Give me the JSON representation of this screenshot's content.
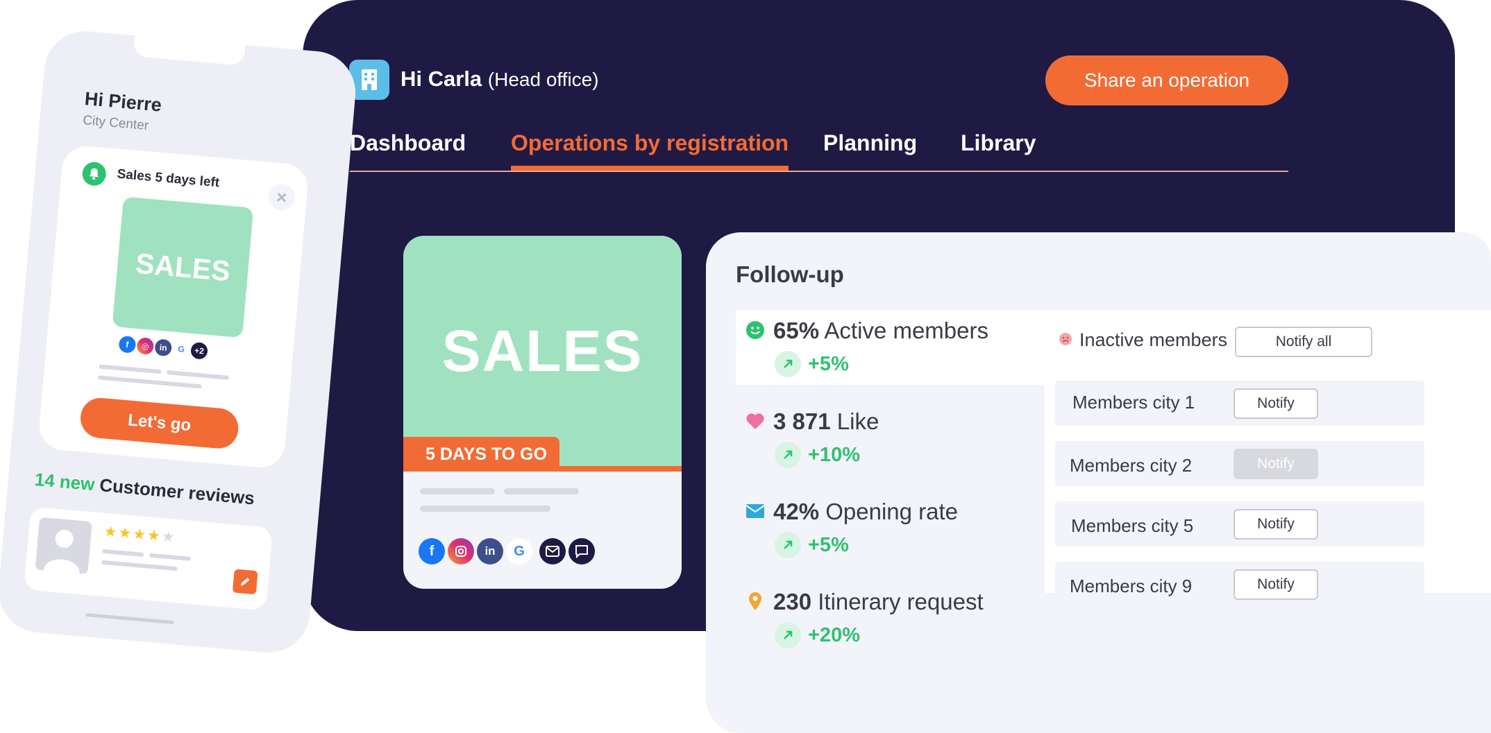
{
  "header": {
    "greeting_name": "Hi Carla",
    "greeting_sub": "(Head office)",
    "share_button": "Share an operation",
    "building_icon": "building-icon"
  },
  "tabs": [
    {
      "label": "Dashboard",
      "active": false
    },
    {
      "label": "Operations by registration",
      "active": true
    },
    {
      "label": "Planning",
      "active": false
    },
    {
      "label": "Library",
      "active": false
    }
  ],
  "sales_card": {
    "banner_text": "SALES",
    "countdown": "5 DAYS TO GO",
    "banner_color": "#a0e2c0",
    "accent_color": "#f26b35",
    "channels": [
      "facebook-icon",
      "instagram-icon",
      "linkedin-icon",
      "google-icon",
      "email-icon",
      "message-icon"
    ]
  },
  "followup": {
    "title": "Follow-up",
    "stats": [
      {
        "icon": "smile-icon",
        "value": "65%",
        "label": "Active members",
        "delta": "+5%"
      },
      {
        "icon": "heart-icon",
        "value": "3 871",
        "label": "Like",
        "delta": "+10%"
      },
      {
        "icon": "envelope-icon",
        "value": "42%",
        "label": "Opening rate",
        "delta": "+5%"
      },
      {
        "icon": "location-pin-icon",
        "value": "230",
        "label": "Itinerary request",
        "delta": "+20%"
      }
    ],
    "inactive": {
      "label": "Inactive members",
      "notify_all": "Notify all",
      "cities": [
        {
          "label": "Members city 1",
          "button": "Notify",
          "disabled": false
        },
        {
          "label": "Members city 2",
          "button": "Notify",
          "disabled": true
        },
        {
          "label": "Members city 5",
          "button": "Notify",
          "disabled": false
        },
        {
          "label": "Members city 9",
          "button": "Notify",
          "disabled": false
        }
      ]
    }
  },
  "phone": {
    "greeting": "Hi Pierre",
    "location": "City Center",
    "alert": "Sales 5 days left",
    "sales_text": "SALES",
    "extra_channels": "+2",
    "cta": "Let's go",
    "reviews_count": "14 new",
    "reviews_label": "Customer reviews",
    "rating": 4,
    "rating_max": 5
  },
  "colors": {
    "dark_bg": "#1f1a44",
    "orange": "#f26b35",
    "green": "#2dc26f",
    "mint": "#a0e2c0",
    "panel": "#f3f4f9"
  }
}
